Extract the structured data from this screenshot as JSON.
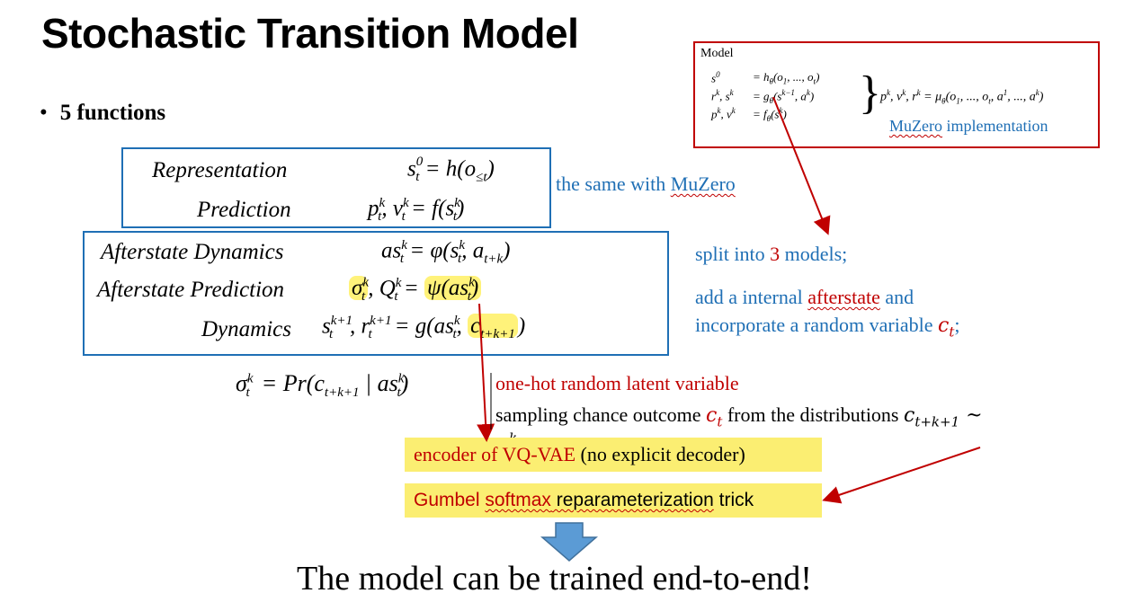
{
  "title": "Stochastic Transition Model",
  "bullet": "5 functions",
  "equations": {
    "representation": {
      "label": "Representation",
      "lhs": "s",
      "lhs_sup": "0",
      "lhs_sub": "t",
      "rhs": "= h(o",
      "rhs_sub": "≤t",
      "rhs_end": ")"
    },
    "prediction": {
      "label": "Prediction",
      "expr": "p, v = f(s)"
    },
    "afterstate_dynamics": {
      "label": "Afterstate Dynamics",
      "expr": "as = φ(s, a)"
    },
    "afterstate_prediction": {
      "label": "Afterstate Prediction",
      "expr": "σ, Q = ψ(as)"
    },
    "dynamics": {
      "label": "Dynamics",
      "expr": "s, r = g(as, c)"
    },
    "sigma_def": "σ = Pr(c | as)"
  },
  "notes": {
    "same_muzero_prefix": "the same with ",
    "same_muzero_link": "MuZero",
    "split_prefix": "split into ",
    "split_num": "3",
    "split_suffix": " models;",
    "add_internal_prefix": "add a internal ",
    "add_internal_word": "afterstate",
    "add_internal_suffix": " and",
    "incorporate": "incorporate a random variable ",
    "c_t": "c",
    "semicolon": ";",
    "one_hot": "one-hot random latent variable",
    "sampling_prefix": "sampling chance outcome ",
    "sampling_mid": " from the distributions ",
    "encoder_red": "encoder of VQ-VAE",
    "encoder_black": " (no explicit decoder)",
    "gumbel_a": "Gumbel ",
    "gumbel_b": "softmax",
    "gumbel_c": " reparameterization",
    "gumbel_d": " trick"
  },
  "model_box": {
    "heading": "Model",
    "row1_l": "s",
    "row1_r": "= h",
    "row2_l": "r, s",
    "row2_r": "= g",
    "row3_l": "p, v",
    "row3_r": "= f",
    "mu": "p, v, r = μ",
    "implementation_link": "MuZero",
    "implementation_text": " implementation"
  },
  "conclusion": "The model can be trained end-to-end!",
  "colors": {
    "blue": "#1f6fb5",
    "red": "#c00000",
    "highlight": "#fbee72",
    "arrow": "#5b9bd5"
  },
  "icons": [
    "down-arrow-icon"
  ]
}
